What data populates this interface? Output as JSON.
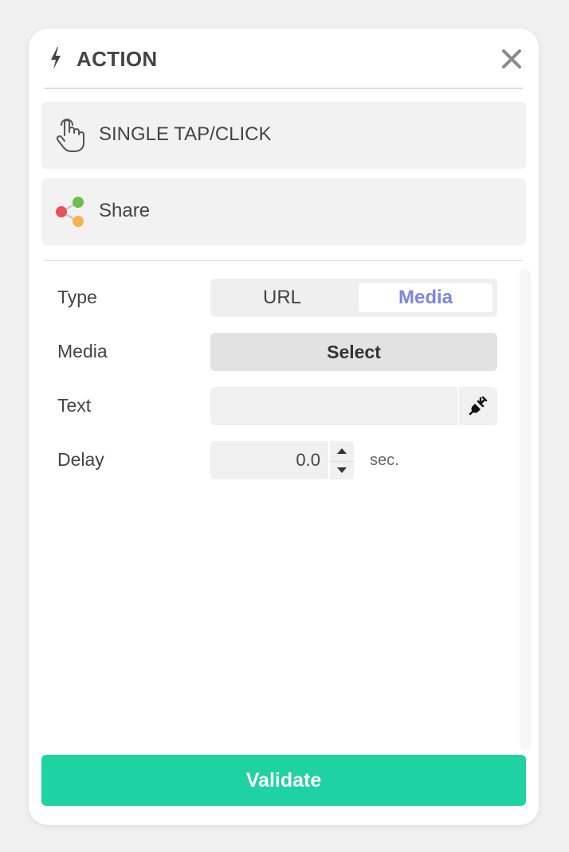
{
  "header": {
    "title": "ACTION",
    "bolt_icon": "lightning-bolt-icon",
    "close_icon": "close-icon"
  },
  "trigger": {
    "label": "SINGLE TAP/CLICK",
    "icon": "hand-pointer-icon"
  },
  "action": {
    "label": "Share",
    "icon": "share-nodes-icon"
  },
  "form": {
    "type": {
      "label": "Type",
      "options": [
        "URL",
        "Media"
      ],
      "selected": "Media"
    },
    "media": {
      "label": "Media",
      "button": "Select"
    },
    "text": {
      "label": "Text",
      "value": "",
      "plugin_icon": "plug-icon"
    },
    "delay": {
      "label": "Delay",
      "value": "0.0",
      "unit": "sec."
    }
  },
  "footer": {
    "validate_label": "Validate"
  },
  "colors": {
    "accent": "#1fd2a2",
    "selected_option": "#7b86e2",
    "share_red": "#e8505b",
    "share_green": "#6cc04a",
    "share_orange": "#f6b24f"
  }
}
